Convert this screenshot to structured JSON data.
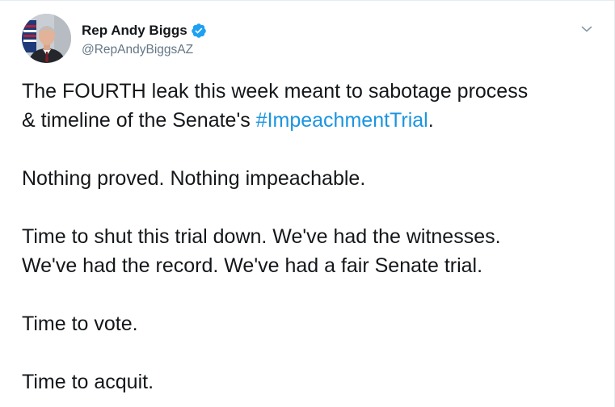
{
  "author": {
    "display_name": "Rep Andy Biggs",
    "handle": "@RepAndyBiggsAZ",
    "verified": true,
    "avatar": "avatar-photo"
  },
  "menu_icon": "chevron-down-icon",
  "tweet": {
    "p1_line1": "The FOURTH leak this week meant to sabotage process",
    "p1_line2_prefix": "& timeline of the Senate's ",
    "p1_hashtag": "#ImpeachmentTrial",
    "p1_line2_suffix": ".",
    "p2": "Nothing proved. Nothing impeachable.",
    "p3_line1": "Time to shut this trial down. We've had the witnesses.",
    "p3_line2": "We've had the record. We've had a fair Senate trial.",
    "p4": "Time to vote.",
    "p5": "Time to acquit."
  },
  "colors": {
    "link": "#1b95e0",
    "verified_badge": "#1da1f2",
    "text": "#14171a",
    "secondary_text": "#657786"
  }
}
